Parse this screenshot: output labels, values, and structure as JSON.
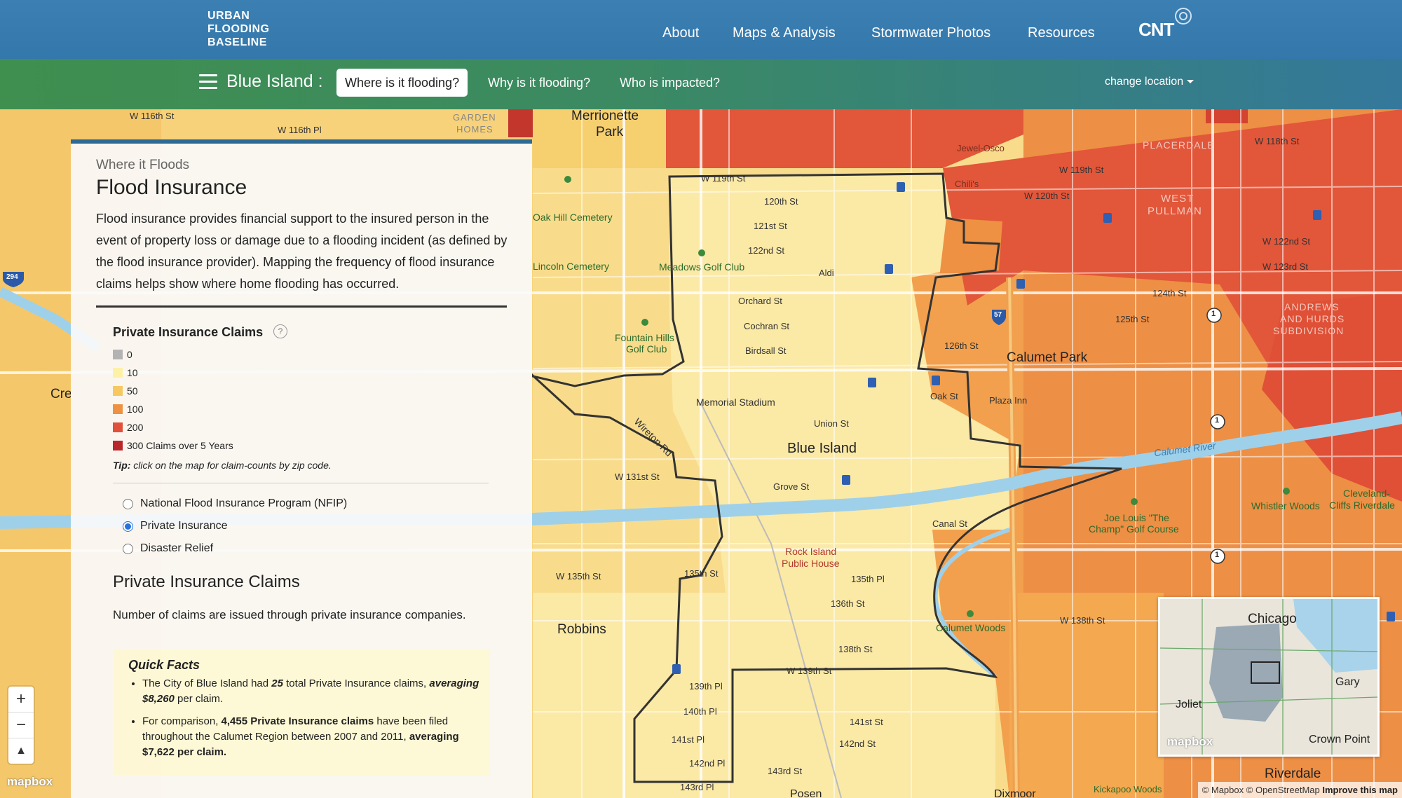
{
  "header": {
    "logo_lines": [
      "URBAN",
      "FLOODING",
      "BASELINE"
    ],
    "nav": [
      "About",
      "Maps & Analysis",
      "Stormwater Photos",
      "Resources"
    ],
    "brand": "CNT"
  },
  "location_bar": {
    "title": "Blue Island :",
    "tabs": [
      {
        "label": "Where is it flooding?",
        "active": true
      },
      {
        "label": "Why is it flooding?",
        "active": false
      },
      {
        "label": "Who is impacted?",
        "active": false
      }
    ],
    "change_location": "change location"
  },
  "panel": {
    "kicker": "Where it Floods",
    "title": "Flood Insurance",
    "intro": "Flood insurance provides financial support to the insured person in the event of property loss or damage due to a flooding incident (as defined by the flood insurance provider). Mapping the frequency of flood insurance claims helps show where home flooding has occurred.",
    "legend": {
      "title": "Private Insurance Claims",
      "help": "?",
      "items": [
        {
          "label": "0",
          "color": "#b3b3b3"
        },
        {
          "label": "10",
          "color": "#fdf1a6"
        },
        {
          "label": "50",
          "color": "#f7c760"
        },
        {
          "label": "100",
          "color": "#ee9142"
        },
        {
          "label": "200",
          "color": "#e0503a"
        },
        {
          "label": "300 Claims over 5 Years",
          "color": "#b9272b"
        }
      ]
    },
    "tip_prefix": "Tip:",
    "tip_text": " click on the map for claim-counts by zip code.",
    "options": [
      {
        "label": "National Flood Insurance Program (NFIP)",
        "selected": false
      },
      {
        "label": "Private Insurance",
        "selected": true
      },
      {
        "label": "Disaster Relief",
        "selected": false
      }
    ],
    "section_title": "Private Insurance Claims",
    "section_text": "Number of claims are issued through private insurance companies.",
    "quick_facts": {
      "title": "Quick Facts",
      "fact1": {
        "a": "The City of Blue Island had ",
        "b": "25",
        "c": " total Private Insurance claims, ",
        "d": "averaging $8,260",
        "e": " per claim."
      },
      "fact2": {
        "a": "For comparison, ",
        "b": "4,455 Private Insurance claims",
        "c": " have been filed throughout the Calumet Region between 2007 and 2011, ",
        "d": "averaging $7,622 per claim."
      }
    }
  },
  "map": {
    "labels": {
      "blue_island": "Blue Island",
      "calumet_park": "Calumet Park",
      "robbins": "Robbins",
      "merrionette": "Merrionette",
      "merrionette2": "Park",
      "riverdale": "Riverdale",
      "posen": "Posen",
      "dixmoor": "Dixmoor",
      "memorial_stadium": "Memorial Stadium",
      "meadows_golf": "Meadows Golf Club",
      "fountain_hills": "Fountain Hills",
      "fountain_hills2": "Golf Club",
      "oak_hill": "Oak Hill Cemetery",
      "lincoln_cem": "Lincoln Cemetery",
      "rock_island": "Rock Island",
      "rock_island2": "Public House",
      "calumet_woods": "Calumet Woods",
      "joe_louis": "Joe Louis \"The",
      "joe_louis2": "Champ\" Golf Course",
      "whistler": "Whistler Woods",
      "cleveland": "Cleveland-",
      "cleveland2": "Cliffs Riverdale",
      "calumet_river": "Calumet River",
      "west_pullman": "WEST",
      "west_pullman2": "PULLMAN",
      "placerdale": "PLACERDALE",
      "andrews": "ANDREWS",
      "andrews2": "AND HURDS",
      "andrews3": "SUBDIVISION",
      "jewel": "Jewel-Osco",
      "aldi": "Aldi",
      "chilis": "Chili's",
      "plaza_inn": "Plaza Inn",
      "garden_homes": "GARDEN",
      "garden_homes2": "HOMES",
      "kickapoo": "Kickapoo Woods",
      "crestwood": "Cre",
      "st_119": "W 119th St",
      "st_120": "120th St",
      "st_121": "121st St",
      "st_122": "122nd St",
      "orchard": "Orchard St",
      "cochran": "Cochran St",
      "birdsall": "Birdsall St",
      "union": "Union St",
      "grove": "Grove St",
      "canal": "Canal St",
      "w131": "W 131st St",
      "w135": "W 135th St",
      "st135": "135th St",
      "pl135": "135th Pl",
      "st136": "136th St",
      "st138": "138th St",
      "w138": "W 138th St",
      "w139": "W 139th St",
      "pl139": "139th Pl",
      "pl140": "140th Pl",
      "pl141": "141st Pl",
      "pl142": "142nd Pl",
      "st141": "141st St",
      "st142": "142nd St",
      "st143": "143rd St",
      "pl143": "143rd Pl",
      "st126": "126th St",
      "st125": "125th St",
      "st124": "124th St",
      "oak_st": "Oak St",
      "wireton": "Wireton Rd",
      "w116": "W 116th St",
      "w116pl": "W 116th Pl",
      "w118": "W 118th St",
      "w119e": "W 119th St",
      "w120e": "W 120th St",
      "w122e": "W 122nd St",
      "w123e": "W 123rd St",
      "route1": "1",
      "route57": "57",
      "route294": "294"
    }
  },
  "minimap": {
    "chicago": "Chicago",
    "gary": "Gary",
    "joliet": "Joliet",
    "crown_point": "Crown Point",
    "logo": "mapbox"
  },
  "zoom": {
    "in": "+",
    "out": "−",
    "reset": "▲"
  },
  "mapbox_logo": "mapbox",
  "attribution": {
    "mapbox": "© Mapbox",
    "osm": "© OpenStreetMap",
    "improve": "Improve this map"
  }
}
